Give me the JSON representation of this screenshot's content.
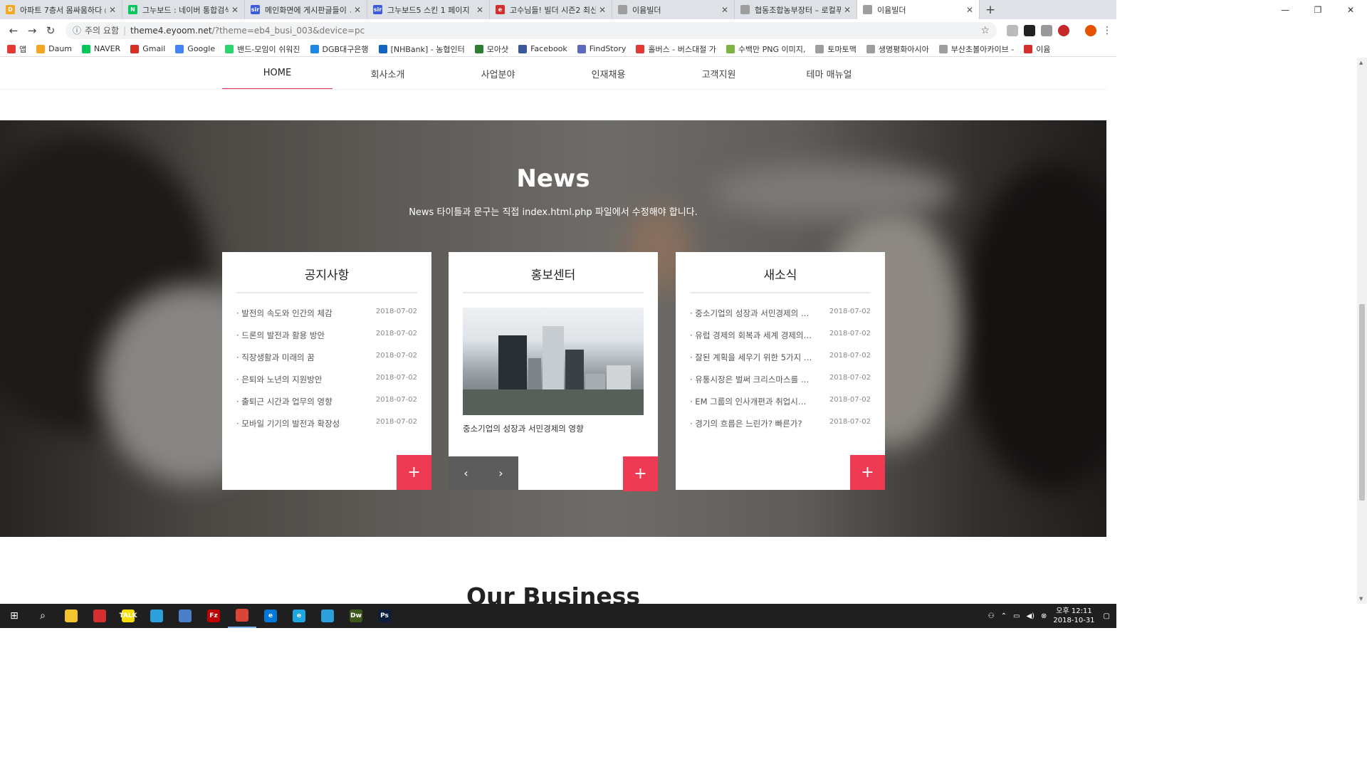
{
  "browser": {
    "tabs": [
      {
        "title": "아파트 7층서 몸싸움하다 ◎",
        "icon": "daum-icon",
        "color": "#f5a623",
        "letter": "D"
      },
      {
        "title": "그누보드 : 네이버 통합검색",
        "icon": "naver-icon",
        "color": "#03c75a",
        "letter": "N"
      },
      {
        "title": "메인화면에 게시판글들이 ↗",
        "icon": "sir-icon",
        "color": "#3b5bdb",
        "letter": "sir"
      },
      {
        "title": "그누보드5 스킨 1 페이지",
        "icon": "sir-icon",
        "color": "#3b5bdb",
        "letter": "sir"
      },
      {
        "title": "고수님들! 빌더 시즌2 최신",
        "icon": "eyoom-icon",
        "color": "#d32f2f",
        "letter": "e"
      },
      {
        "title": "이윰빌더",
        "icon": "page-icon",
        "color": "#9e9e9e",
        "letter": ""
      },
      {
        "title": "협동조합농부장터 – 로컬푸",
        "icon": "page-icon",
        "color": "#9e9e9e",
        "letter": ""
      },
      {
        "title": "이윰빌더",
        "icon": "page-icon",
        "color": "#9e9e9e",
        "letter": "",
        "active": true
      }
    ],
    "new_tab": "+",
    "url_warning": "주의 요함",
    "url_host": "theme4.eyoom.net",
    "url_path": "/?theme=eb4_busi_003&device=pc",
    "bookmarks": [
      {
        "label": "앱",
        "color": "#e53935"
      },
      {
        "label": "Daum",
        "color": "#f5a623"
      },
      {
        "label": "NAVER",
        "color": "#03c75a"
      },
      {
        "label": "Gmail",
        "color": "#d93025"
      },
      {
        "label": "Google",
        "color": "#4285f4"
      },
      {
        "label": "밴드-모임이 쉬워진",
        "color": "#2dd36f"
      },
      {
        "label": "DGB대구은행",
        "color": "#1e88e5"
      },
      {
        "label": "[NHBank] - 농협인터",
        "color": "#1565c0"
      },
      {
        "label": "모아샷",
        "color": "#2e7d32"
      },
      {
        "label": "Facebook",
        "color": "#3b5998"
      },
      {
        "label": "FindStory",
        "color": "#5c6bc0"
      },
      {
        "label": "홀버스 - 버스대절 가",
        "color": "#e53935"
      },
      {
        "label": "수백만 PNG 이미지,",
        "color": "#7cb342"
      },
      {
        "label": "토마토맥",
        "color": "#9e9e9e"
      },
      {
        "label": "생명평화아시아",
        "color": "#9e9e9e"
      },
      {
        "label": "부산초볼아카이브 -",
        "color": "#9e9e9e"
      },
      {
        "label": "이윰",
        "color": "#d32f2f"
      }
    ]
  },
  "site": {
    "nav": [
      {
        "label": "HOME",
        "active": true
      },
      {
        "label": "회사소개"
      },
      {
        "label": "사업분야"
      },
      {
        "label": "인재채용"
      },
      {
        "label": "고객지원"
      },
      {
        "label": "테마 매뉴얼"
      }
    ],
    "news": {
      "title": "News",
      "subtitle": "News 타이틀과 문구는 직접 index.html.php 파일에서 수정해야 합니다.",
      "notice": {
        "title": "공지사항",
        "items": [
          {
            "text": "· 발전의 속도와 인간의 체감",
            "date": "2018-07-02"
          },
          {
            "text": "· 드론의 발전과 활용 방안",
            "date": "2018-07-02"
          },
          {
            "text": "· 직장생활과 미래의 꿈",
            "date": "2018-07-02"
          },
          {
            "text": "· 은퇴와 노년의 지원방안",
            "date": "2018-07-02"
          },
          {
            "text": "· 출퇴근 시간과 업무의 영향",
            "date": "2018-07-02"
          },
          {
            "text": "· 모바일 기기의 발전과 확장성",
            "date": "2018-07-02"
          }
        ]
      },
      "pr": {
        "title": "홍보센터",
        "caption": "중소기업의 성장과 서민경제의 영향",
        "prev": "‹",
        "next": "›"
      },
      "newsfeed": {
        "title": "새소식",
        "items": [
          {
            "text": "· 중소기업의 성장과 서민경제의 …",
            "date": "2018-07-02"
          },
          {
            "text": "· 유럽 경제의 회복과 세계 경제의…",
            "date": "2018-07-02"
          },
          {
            "text": "· 잘된 계획을 세우기 위한 5가지 …",
            "date": "2018-07-02"
          },
          {
            "text": "· 유통시장은 벌써 크리스마스를 …",
            "date": "2018-07-02"
          },
          {
            "text": "· EM 그룹의 인사개편과 취업시…",
            "date": "2018-07-02"
          },
          {
            "text": "· 경기의 흐름은 느린가? 빠른가?",
            "date": "2018-07-02"
          }
        ]
      },
      "more": "+"
    },
    "business_title": "Our Business",
    "to_top": "⌃"
  },
  "taskbar": {
    "clock_ampm_time": "오후 12:11",
    "clock_date": "2018-10-31",
    "apps": [
      {
        "name": "file-explorer-icon",
        "color": "#f4c430",
        "letter": ""
      },
      {
        "name": "app-red-icon",
        "color": "#d32f2f",
        "letter": ""
      },
      {
        "name": "kakaotalk-icon",
        "color": "#f9e000",
        "letter": "TALK"
      },
      {
        "name": "telegram-icon",
        "color": "#2aa1da",
        "letter": ""
      },
      {
        "name": "app-blue-icon",
        "color": "#4a7ec9",
        "letter": ""
      },
      {
        "name": "filezilla-icon",
        "color": "#bf0000",
        "letter": "Fz"
      },
      {
        "name": "chrome-icon",
        "color": "#db4437",
        "letter": "",
        "running": true
      },
      {
        "name": "edge-icon",
        "color": "#0078d7",
        "letter": "e"
      },
      {
        "name": "ie-icon",
        "color": "#1ea7e1",
        "letter": "e"
      },
      {
        "name": "telegram2-icon",
        "color": "#2aa1da",
        "letter": ""
      },
      {
        "name": "dreamweaver-icon",
        "color": "#3d5a1c",
        "letter": "Dw"
      },
      {
        "name": "photoshop-icon",
        "color": "#0a1e3b",
        "letter": "Ps"
      }
    ]
  }
}
